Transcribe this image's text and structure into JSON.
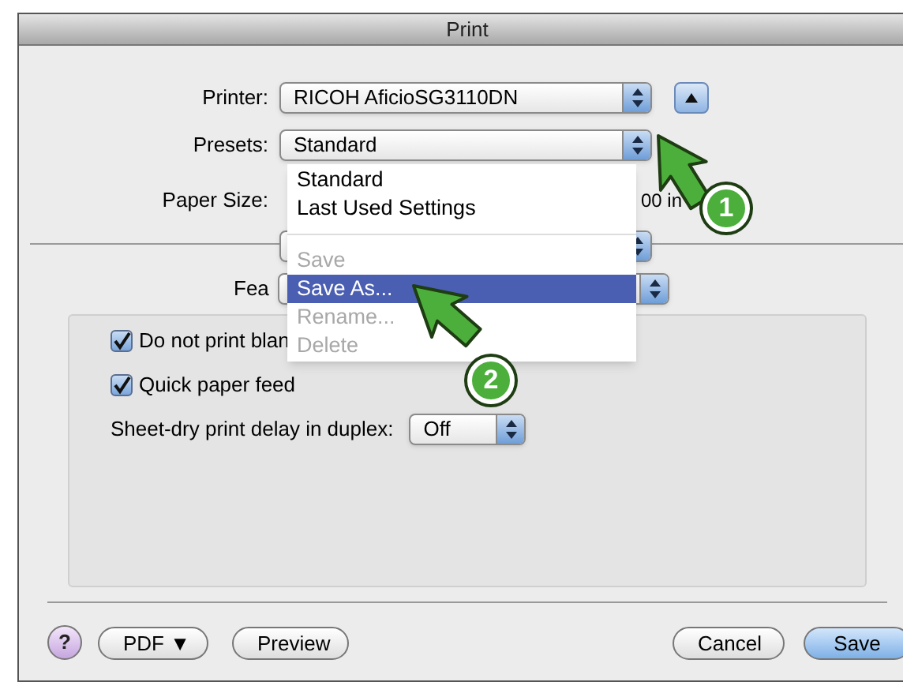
{
  "window": {
    "title": "Print"
  },
  "printer": {
    "label": "Printer:",
    "value": "RICOH AficioSG3110DN"
  },
  "presets": {
    "label": "Presets:",
    "value": "Standard"
  },
  "paper_size": {
    "label": "Paper Size:",
    "value": "00 in"
  },
  "features": {
    "label": "Fea"
  },
  "presets_menu": [
    {
      "kind": "item",
      "label": "Standard",
      "selected": false,
      "disabled": false
    },
    {
      "kind": "item",
      "label": "Last Used Settings",
      "selected": false,
      "disabled": false
    },
    {
      "kind": "separator"
    },
    {
      "kind": "item",
      "label": "Save",
      "selected": false,
      "disabled": true
    },
    {
      "kind": "item",
      "label": "Save As...",
      "selected": true,
      "disabled": false
    },
    {
      "kind": "item",
      "label": "Rename...",
      "selected": false,
      "disabled": true
    },
    {
      "kind": "item",
      "label": "Delete",
      "selected": false,
      "disabled": true
    }
  ],
  "options": [
    {
      "kind": "checkbox",
      "label": "Do not print blan",
      "checked": true
    },
    {
      "kind": "checkbox",
      "label": "Quick paper feed",
      "checked": true
    },
    {
      "kind": "select",
      "label": "Sheet-dry print delay in duplex:",
      "value": "Off"
    }
  ],
  "help": "?",
  "buttons_left": [
    {
      "label": "PDF ▼",
      "default": false
    },
    {
      "label": "Preview",
      "default": false
    }
  ],
  "buttons_right": [
    {
      "label": "Cancel",
      "default": false
    },
    {
      "label": "Save",
      "default": true
    }
  ],
  "callouts": [
    {
      "number": "1"
    },
    {
      "number": "2"
    }
  ]
}
